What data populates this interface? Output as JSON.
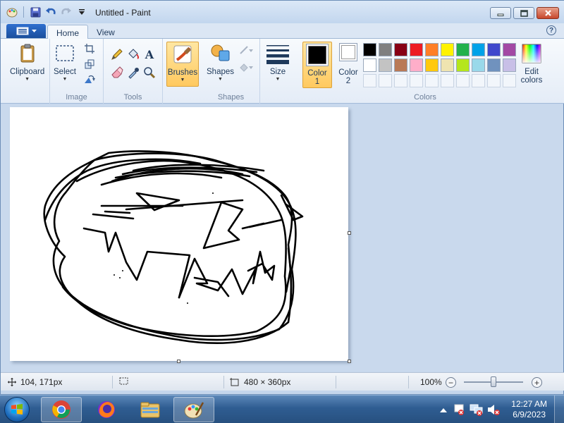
{
  "window": {
    "title": "Untitled - Paint"
  },
  "tabs": [
    {
      "label": "Home",
      "active": true
    },
    {
      "label": "View",
      "active": false
    }
  ],
  "ribbon": {
    "groups": {
      "clipboard": {
        "button_label": "Clipboard"
      },
      "image": {
        "label": "Image",
        "select_label": "Select"
      },
      "tools": {
        "label": "Tools"
      },
      "brushes": {
        "button_label": "Brushes"
      },
      "shapes": {
        "label": "Shapes",
        "button_label": "Shapes"
      },
      "size": {
        "button_label": "Size"
      },
      "colors": {
        "label": "Colors",
        "color1_label_1": "Color",
        "color1_label_2": "1",
        "color2_label_1": "Color",
        "color2_label_2": "2",
        "edit_label_1": "Edit",
        "edit_label_2": "colors",
        "color1_value": "#000000",
        "color2_value": "#ffffff",
        "palette_row1": [
          "#000000",
          "#7f7f7f",
          "#880015",
          "#ed1c24",
          "#ff7f27",
          "#fff200",
          "#22b14c",
          "#00a2e8",
          "#3f48cc",
          "#a349a4"
        ],
        "palette_row2": [
          "#ffffff",
          "#c3c3c3",
          "#b97a57",
          "#ffaec9",
          "#ffc90e",
          "#efe4b0",
          "#b5e61d",
          "#99d9ea",
          "#7092be",
          "#c8bfe7"
        ]
      }
    }
  },
  "status": {
    "cursor_pos": "104, 171px",
    "canvas_size": "480 × 360px",
    "zoom": "100%",
    "zoom_level_fraction": 0.5
  },
  "taskbar": {
    "clock_time": "12:27 AM",
    "clock_date": "6/9/2023",
    "apps": [
      "chrome-icon",
      "firefox-icon",
      "file-explorer-icon",
      "paint-icon"
    ]
  }
}
